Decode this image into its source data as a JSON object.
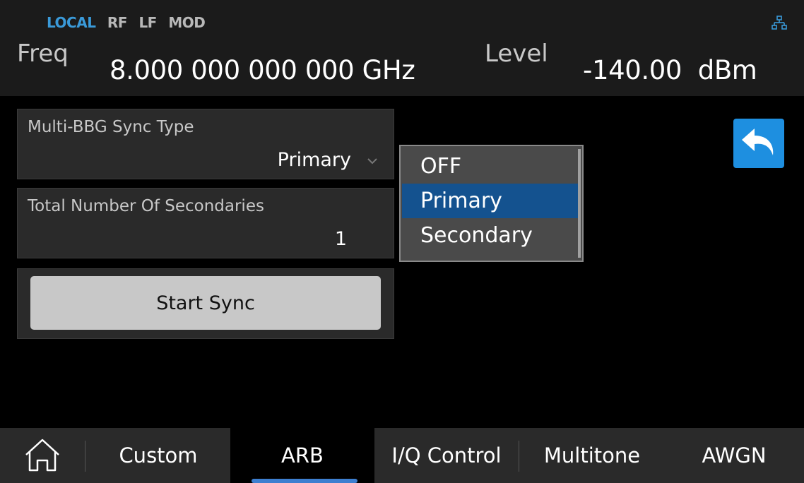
{
  "header": {
    "status_items": [
      "LOCAL",
      "RF",
      "LF",
      "MOD"
    ],
    "freq_label": "Freq",
    "freq_value": "8.000 000 000 000 GHz",
    "level_label": "Level",
    "level_value": "-140.00  dBm",
    "network_icon": "network-icon"
  },
  "sync_type": {
    "label": "Multi-BBG Sync Type",
    "value": "Primary"
  },
  "secondaries": {
    "label": "Total Number Of Secondaries",
    "value": "1"
  },
  "start_sync": {
    "label": "Start Sync"
  },
  "dropdown": {
    "options": [
      "OFF",
      "Primary",
      "Secondary"
    ],
    "selected": "Primary"
  },
  "nav": {
    "home_icon": "home-icon",
    "tabs": [
      "Custom",
      "ARB",
      "I/Q Control",
      "Multitone",
      "AWGN"
    ],
    "active": "ARB"
  },
  "colors": {
    "accent": "#1e8fe0",
    "selected": "#14528f",
    "local": "#3a9ad9"
  }
}
